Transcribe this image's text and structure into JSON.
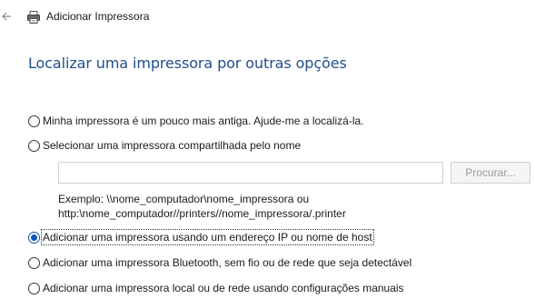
{
  "window": {
    "title": "Adicionar Impressora",
    "back_icon": "arrow-left-icon",
    "app_icon": "printer-icon"
  },
  "heading": "Localizar uma impressora por outras opções",
  "options": [
    {
      "label": "Minha impressora é um pouco mais antiga. Ajude-me a localizá-la.",
      "checked": false
    },
    {
      "label": "Selecionar uma impressora compartilhada pelo nome",
      "checked": false
    },
    {
      "label": "Adicionar uma impressora usando um endereço IP ou nome de host",
      "checked": true
    },
    {
      "label": "Adicionar uma impressora Bluetooth, sem fio ou de rede que seja detectável",
      "checked": false
    },
    {
      "label": "Adicionar uma impressora local ou de rede usando configurações manuais",
      "checked": false
    }
  ],
  "shared_printer": {
    "value": "",
    "browse_label": "Procurar...",
    "example_line1": "Exemplo: \\\\nome_computador\\nome_impressora ou",
    "example_line2": "http:\\nome_computador//printers//nome_impressora/.printer"
  },
  "colors": {
    "heading": "#1f4e8c",
    "accent": "#0a57b7",
    "disabled_text": "#9a9a9a"
  }
}
